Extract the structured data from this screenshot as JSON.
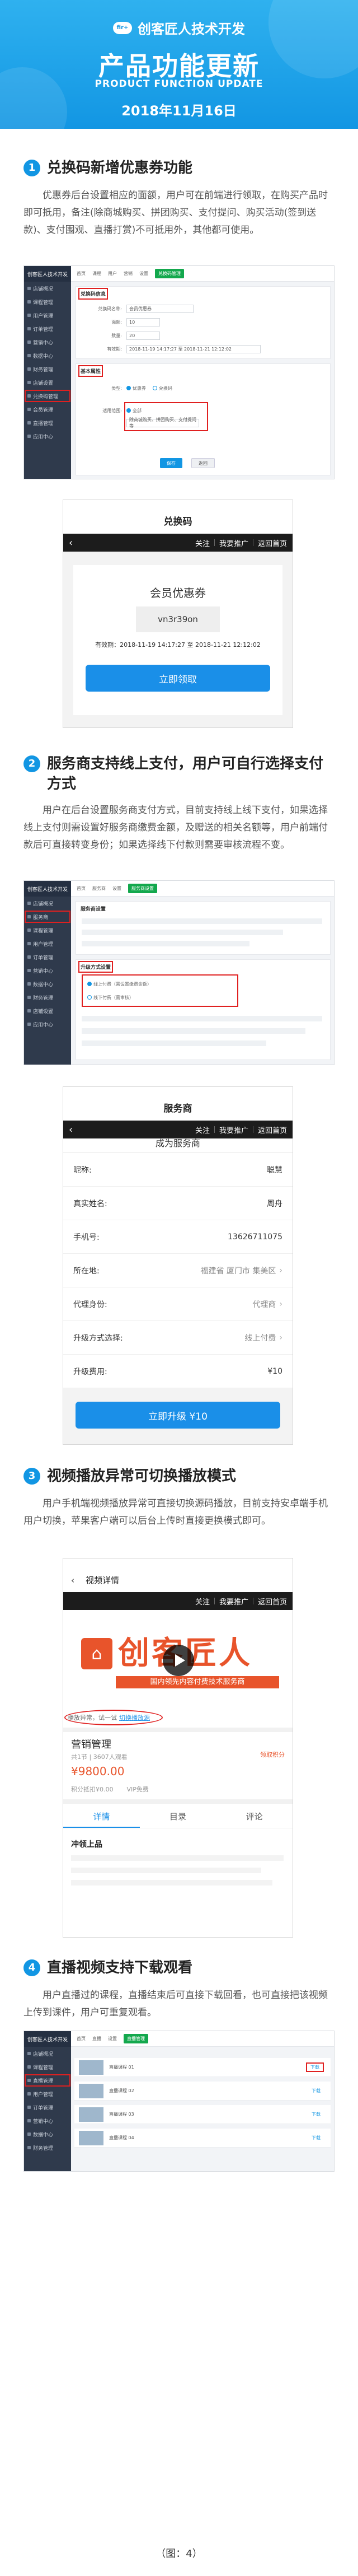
{
  "header": {
    "brand_logo": "fir+",
    "brand": "创客匠人技术开发",
    "title": "产品功能更新",
    "subtitle": "PRODUCT FUNCTION UPDATE",
    "date": "2018年11月16日"
  },
  "colors": {
    "primary": "#1296e3",
    "highlight": "#e02020",
    "brand_orange": "#e8542b",
    "button_blue": "#1a8fe8",
    "admin_sidebar": "#2f3a4c"
  },
  "sections": [
    {
      "number": "1",
      "title": "兑换码新增优惠券功能",
      "description": "优惠券后台设置相应的面额，用户可在前端进行领取，在购买产品时即可抵用，备注(除商城购买、拼团购买、支付提问、购买活动(签到送款)、支付围观、直播打赏)不可抵用外，其他都可使用。"
    },
    {
      "number": "2",
      "title": "服务商支持线上支付，用户可自行选择支付方式",
      "description": "用户在后台设置服务商支付方式，目前支持线上线下支付，如果选择线上支付则需设置好服务商缴费金额，及赠送的相关名额等，用户前端付款后可直接转变身份；如果选择线下付款则需要审核流程不变。"
    },
    {
      "number": "3",
      "title": "视频播放异常可切换播放模式",
      "description": "用户手机端视频播放异常可直接切换源码播放，目前支持安卓端手机用户切换，苹果客户端可以后台上传时直接更换模式即可。"
    },
    {
      "number": "4",
      "title": "直播视频支持下载观看",
      "description": "用户直播过的课程，直播结束后可直接下载回看，也可直接把该视频上传到课件，用户可重复观看。"
    }
  ],
  "admin1": {
    "tabs": [
      "首页",
      "课程",
      "用户",
      "营销",
      "设置"
    ],
    "active_tab": "兑换码管理",
    "panel1_title": "兑换码信息",
    "panel2_title": "基本属性",
    "fields": [
      {
        "label": "兑换码名称:",
        "value": "会员优惠券"
      },
      {
        "label": "面额:",
        "value": "10"
      },
      {
        "label": "数量:",
        "value": "20"
      },
      {
        "label": "有效期:",
        "value": "2018-11-19 14:17:27  至  2018-11-21 12:12:02"
      }
    ],
    "type_label": "类型:",
    "type_options": [
      "优惠券",
      "兑换码"
    ],
    "scope_label": "适用范围:",
    "scope_value": "全部",
    "scope_note": "除商城购买、拼团购买、支付提问等",
    "save": "保存",
    "cancel": "返回",
    "sidebar": [
      "店铺概况",
      "课程管理",
      "用户管理",
      "订单管理",
      "营销中心",
      "数据中心",
      "财务管理",
      "店铺设置",
      "兑换码管理",
      "会员管理",
      "直播管理",
      "应用中心"
    ]
  },
  "coupon_phone": {
    "title": "兑换码",
    "nav": [
      "关注",
      "我要推广",
      "返回首页"
    ],
    "coupon_title": "会员优惠券",
    "code": "vn3r39on",
    "validity": "有效期：2018-11-19 14:17:27  至  2018-11-21 12:12:02",
    "button": "立即领取"
  },
  "admin2": {
    "tabs": [
      "首页",
      "服务商",
      "设置"
    ],
    "active_tab": "服务商设置",
    "panel1_title": "服务商设置",
    "panel2_title": "升级方式设置",
    "options": [
      "线上付费（需设置缴费金额）",
      "线下付费（需审核）"
    ],
    "sidebar": [
      "店铺概况",
      "服务商",
      "课程管理",
      "用户管理",
      "订单管理",
      "营销中心",
      "数据中心",
      "财务管理",
      "店铺设置",
      "应用中心"
    ]
  },
  "provider_phone": {
    "title": "服务商",
    "nav": [
      "关注",
      "我要推广",
      "返回首页"
    ],
    "heading": "成为服务商",
    "rows": [
      {
        "label": "昵称:",
        "value": "聪慧",
        "muted": false,
        "arrow": false
      },
      {
        "label": "真实姓名:",
        "value": "周舟",
        "muted": false,
        "arrow": false
      },
      {
        "label": "手机号:",
        "value": "13626711075",
        "muted": false,
        "arrow": false
      },
      {
        "label": "所在地:",
        "value": "福建省 厦门市 集美区",
        "muted": true,
        "arrow": true
      },
      {
        "label": "代理身份:",
        "value": "代理商",
        "muted": true,
        "arrow": true
      },
      {
        "label": "升级方式选择:",
        "value": "线上付费",
        "muted": true,
        "arrow": true
      },
      {
        "label": "升级费用:",
        "value": "¥10",
        "muted": false,
        "arrow": false
      }
    ],
    "button": "立即升级  ¥10"
  },
  "video_phone": {
    "title": "视频详情",
    "nav": [
      "关注",
      "我要推广",
      "返回首页"
    ],
    "logo_mark": "⌂",
    "logo_text": "创客匠人",
    "logo_tagline": "国内领先内容付费技术服务商",
    "switch_notice": "播放异常，试一试",
    "switch_link": "切换播放源",
    "course_name": "营销管理",
    "meta": "共1节 | 3607人观看",
    "price": "¥9800.00",
    "points": "积分抵扣¥0.00",
    "vip": "VIP免费",
    "collect": "领取积分",
    "tabs": [
      "详情",
      "目录",
      "评论"
    ],
    "footer_brand": "冲领上品"
  },
  "admin4": {
    "tabs": [
      "首页",
      "直播",
      "设置"
    ],
    "active_tab": "直播管理",
    "rows": [
      "直播课程 01",
      "直播课程 02",
      "直播课程 03",
      "直播课程 04"
    ],
    "download": "下载",
    "sidebar": [
      "店铺概况",
      "课程管理",
      "直播管理",
      "用户管理",
      "订单管理",
      "营销中心",
      "数据中心",
      "财务管理"
    ]
  },
  "caption": "（图：4）"
}
